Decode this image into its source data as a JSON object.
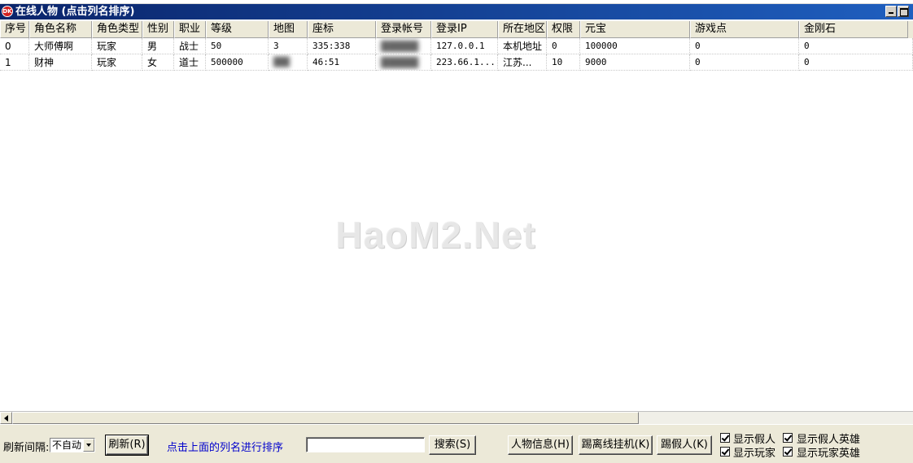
{
  "window": {
    "title": "在线人物 (点击列名排序)",
    "icon": "app-icon"
  },
  "grid": {
    "columns": [
      "序号",
      "角色名称",
      "角色类型",
      "性别",
      "职业",
      "等级",
      "地图",
      "座标",
      "登录帐号",
      "登录IP",
      "所在地区",
      "权限",
      "元宝",
      "游戏点",
      "金刚石"
    ],
    "rows": [
      [
        "0",
        "大师傅啊",
        "玩家",
        "男",
        "战士",
        "50",
        "3",
        "335:338",
        "",
        "127.0.0.1",
        "本机地址",
        "0",
        "100000",
        "0",
        "0"
      ],
      [
        "1",
        "财神",
        "玩家",
        "女",
        "道士",
        "500000",
        "",
        "46:51",
        "",
        "223.66.1...",
        "江苏...",
        "10",
        "9000",
        "0",
        "0"
      ]
    ]
  },
  "watermark": "HaoM2.Net",
  "bottom": {
    "refresh_interval_label": "刷新间隔:",
    "refresh_interval_value": "不自动",
    "refresh_button": "刷新(R)",
    "hint": "点击上面的列名进行排序",
    "search_value": "",
    "search_button": "搜索(S)",
    "player_info_button": "人物信息(H)",
    "kick_offline_button": "踢离线挂机(K)",
    "kick_fake_button": "踢假人(K)",
    "checkboxes": [
      {
        "label": "显示假人",
        "checked": true
      },
      {
        "label": "显示假人英雄",
        "checked": true
      },
      {
        "label": "显示玩家",
        "checked": true
      },
      {
        "label": "显示玩家英雄",
        "checked": true
      }
    ]
  }
}
